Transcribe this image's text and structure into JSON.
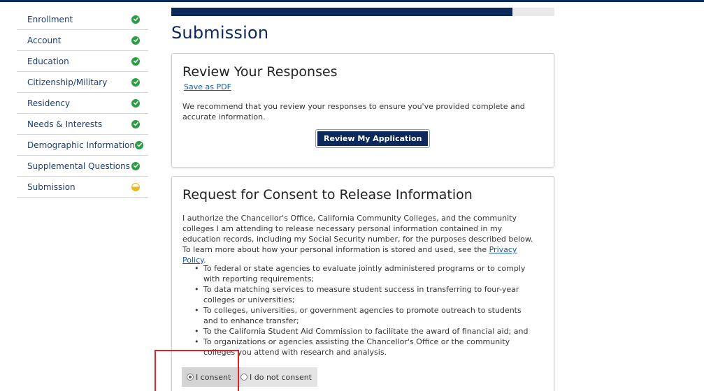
{
  "progress": {
    "percent": 89
  },
  "sidebar": {
    "items": [
      {
        "label": "Enrollment",
        "status": "complete"
      },
      {
        "label": "Account",
        "status": "complete"
      },
      {
        "label": "Education",
        "status": "complete"
      },
      {
        "label": "Citizenship/Military",
        "status": "complete"
      },
      {
        "label": "Residency",
        "status": "complete"
      },
      {
        "label": "Needs & Interests",
        "status": "complete"
      },
      {
        "label": "Demographic Information",
        "status": "complete"
      },
      {
        "label": "Supplemental Questions",
        "status": "complete"
      },
      {
        "label": "Submission",
        "status": "in-progress"
      }
    ]
  },
  "page": {
    "title": "Submission"
  },
  "review": {
    "title": "Review Your Responses",
    "pdf_link": "Save as PDF",
    "text": "We recommend that you review your responses to ensure you've provided complete and accurate information.",
    "button": "Review My Application"
  },
  "consent": {
    "title": "Request for Consent to Release Information",
    "text": "I authorize the Chancellor's Office, California Community Colleges, and the community colleges I am attending to release necessary personal information contained in my education records, including my Social Security number, for the purposes described below. To learn more about how your personal information is stored and used, see the",
    "privacy_link": "Privacy Policy",
    "text_end": ".",
    "purposes": [
      "To federal or state agencies to evaluate jointly administered programs or to comply with reporting requirements;",
      "To data matching services to measure student success in transferring to four-year colleges or universities;",
      "To colleges, universities, or government agencies to promote outreach to students and to enhance transfer;",
      "To the California Student Aid Commission to facilitate the award of financial aid; and",
      "To organizations or agencies assisting the Chancellor's Office or the community colleges you attend with research and analysis."
    ],
    "options": [
      "I consent",
      "I do not consent"
    ],
    "selected": "I consent"
  },
  "colors": {
    "brand_navy": "#0b2a5b",
    "complete_green": "#2e9c44",
    "in_progress_yellow": "#e9b823",
    "annotation_red": "#d9232a"
  },
  "icons": {
    "complete": "check-circle-icon",
    "in_progress": "half-circle-icon"
  }
}
